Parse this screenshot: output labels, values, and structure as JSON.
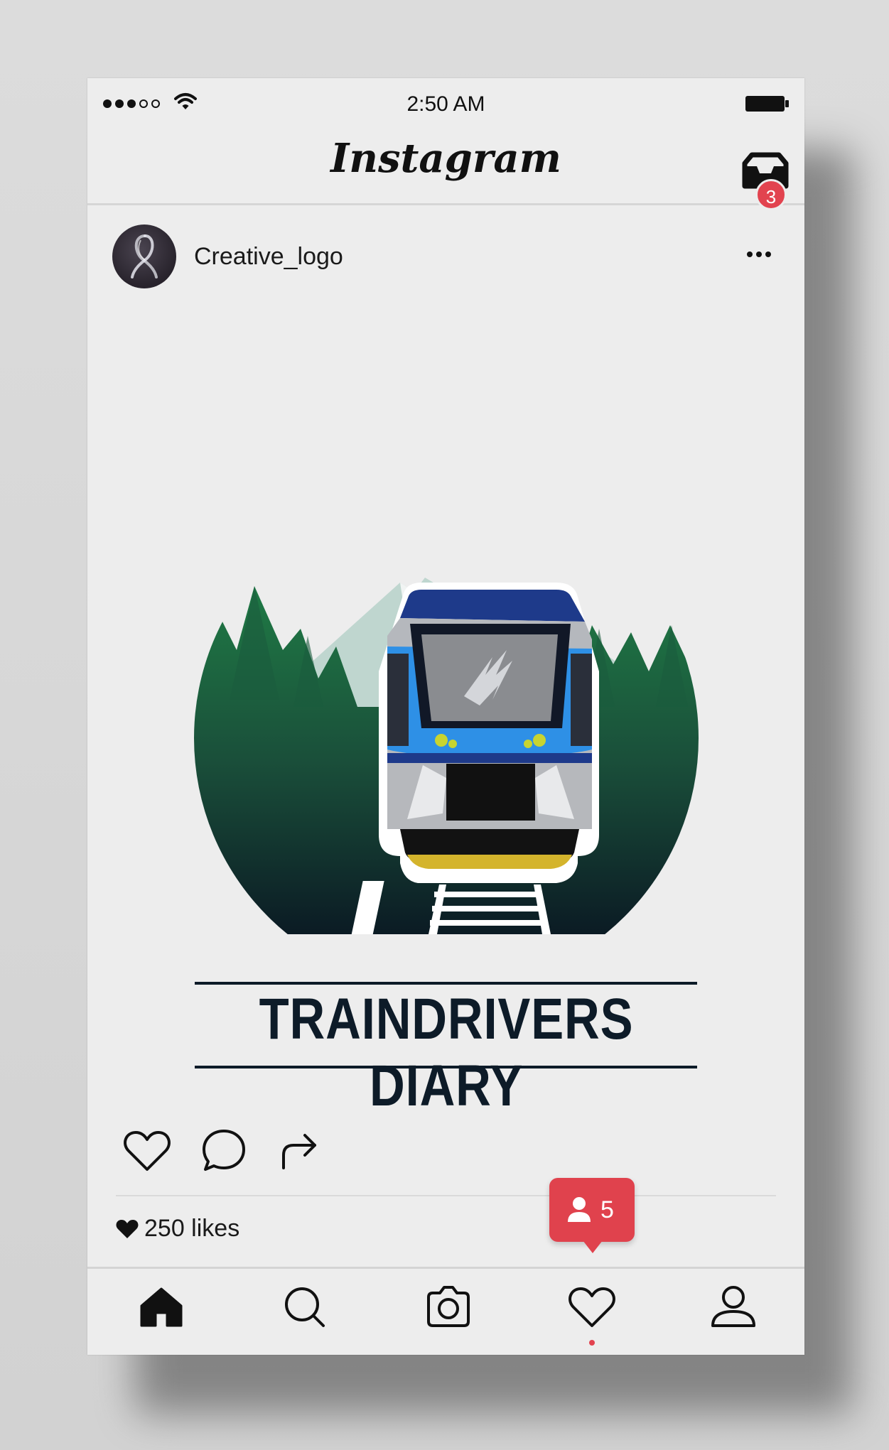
{
  "status_bar": {
    "time": "2:50 AM",
    "signal_bars_filled": 3,
    "signal_bars_total": 5,
    "icons": [
      "signal-dots-icon",
      "wifi-icon",
      "battery-icon"
    ]
  },
  "header": {
    "app_title": "Instagram",
    "inbox_icon": "inbox-icon",
    "inbox_badge_count": "3"
  },
  "post": {
    "username": "Creative_logo",
    "avatar_icon": "avatar-ribbon-icon",
    "more_icon": "more-dots-icon",
    "image": {
      "logo_text": "TRAINDRIVERS DIARY",
      "colors": {
        "train_blue": "#2e90e6",
        "train_navy": "#1e3a8a",
        "forest_green": "#1c6b3e",
        "dark_navy": "#0d1b28",
        "mountain": "#bfd6cf",
        "bumper_yellow": "#d4b42c"
      }
    },
    "actions": {
      "like_icon": "heart-outline-icon",
      "comment_icon": "comment-icon",
      "share_icon": "share-arrow-icon"
    },
    "likes_label": "250 likes",
    "likes_icon": "heart-filled-icon"
  },
  "notification": {
    "count": "5",
    "icon": "user-follow-icon",
    "color": "#e0424d"
  },
  "bottom_nav": {
    "items": [
      "home-icon",
      "search-icon",
      "camera-icon",
      "heart-icon",
      "profile-icon"
    ],
    "active_indicator_color": "#e2434f"
  }
}
